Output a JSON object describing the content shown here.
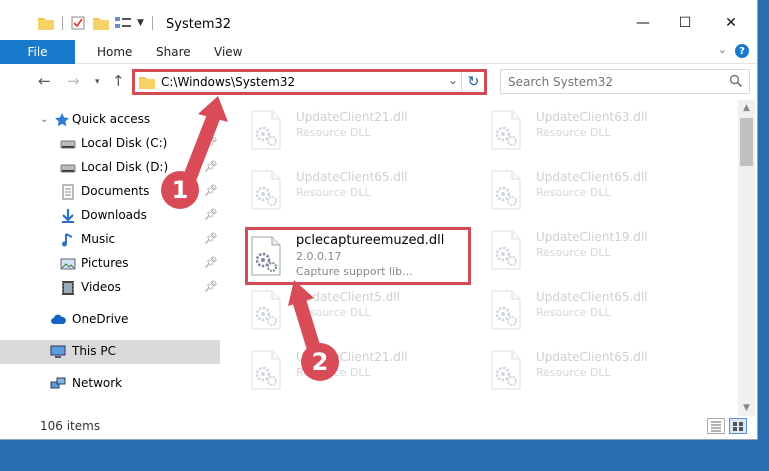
{
  "window": {
    "title": "System32",
    "controls": {
      "minimize": "—",
      "maximize": "☐",
      "close": "✕"
    }
  },
  "ribbon": {
    "tabs": [
      "File",
      "Home",
      "Share",
      "View"
    ],
    "help": "?"
  },
  "address": {
    "path": "C:\\Windows\\System32",
    "search_placeholder": "Search System32"
  },
  "nav": {
    "quick_access": "Quick access",
    "items": [
      {
        "label": "Local Disk (C:)",
        "icon": "drive-icon",
        "pinned": true
      },
      {
        "label": "Local Disk (D:)",
        "icon": "drive-icon",
        "pinned": true
      },
      {
        "label": "Documents",
        "icon": "documents-icon",
        "pinned": true
      },
      {
        "label": "Downloads",
        "icon": "downloads-icon",
        "pinned": true
      },
      {
        "label": "Music",
        "icon": "music-icon",
        "pinned": true
      },
      {
        "label": "Pictures",
        "icon": "pictures-icon",
        "pinned": true
      },
      {
        "label": "Videos",
        "icon": "videos-icon",
        "pinned": true
      }
    ],
    "onedrive": "OneDrive",
    "this_pc": "This PC",
    "network": "Network"
  },
  "files": {
    "highlighted": {
      "name": "pclecaptureemuzed.dll",
      "version": "2.0.0.17",
      "description": "Capture support lib..."
    },
    "left_column": [
      {
        "name": "UpdateClient21.dll",
        "desc": "Resource DLL"
      },
      {
        "name": "UpdateClient65.dll",
        "desc": "Resource DLL"
      },
      {
        "name": "UpdateClient5.dll",
        "desc": "Resource DLL"
      },
      {
        "name": "UpdateClient21.dll",
        "desc": "Resource DLL"
      }
    ],
    "right_column": [
      {
        "name": "UpdateClient63.dll",
        "desc": "Resource DLL"
      },
      {
        "name": "UpdateClient65.dll",
        "desc": "Resource DLL"
      },
      {
        "name": "UpdateClient19.dll",
        "desc": "Resource DLL"
      },
      {
        "name": "UpdateClient65.dll",
        "desc": "Resource DLL"
      },
      {
        "name": "UpdateClient65.dll",
        "desc": "Resource DLL"
      }
    ]
  },
  "status": {
    "items": "106 items"
  },
  "annotations": {
    "step1": "1",
    "step2": "2"
  },
  "colors": {
    "accent": "#1979ca",
    "highlight": "#d24a55"
  }
}
